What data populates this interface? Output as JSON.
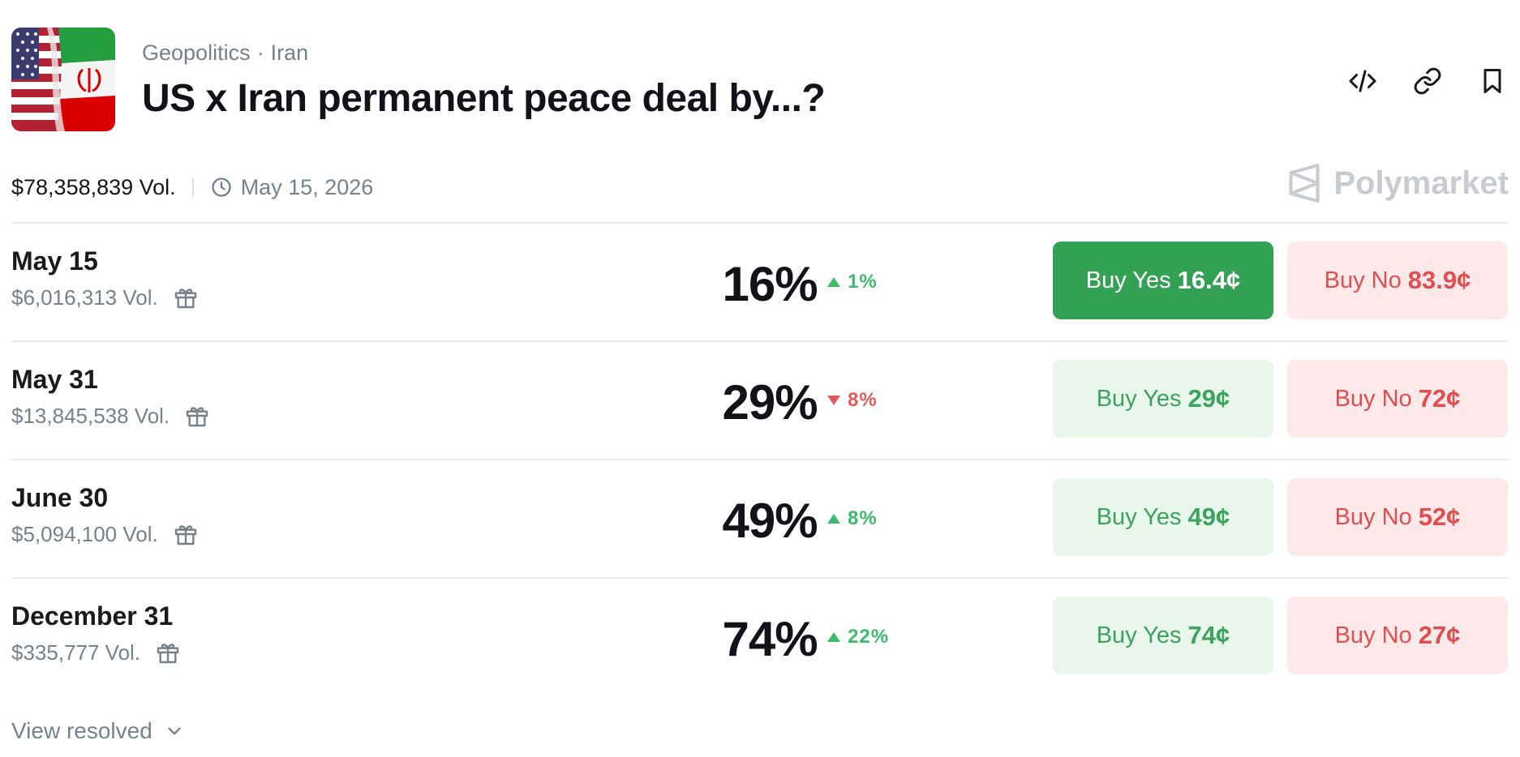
{
  "header": {
    "category": "Geopolitics",
    "subcategory": "Iran",
    "title": "US x Iran permanent peace deal by...?",
    "image_icon": "us-iran-flags-image",
    "actions": [
      {
        "name": "embed-icon"
      },
      {
        "name": "link-icon"
      },
      {
        "name": "bookmark-icon"
      }
    ]
  },
  "meta": {
    "volume": "$78,358,839 Vol.",
    "date": "May 15, 2026",
    "clock_icon": "clock-icon"
  },
  "brand": {
    "name": "Polymarket"
  },
  "markets": [
    {
      "label": "May 15",
      "volume": "$6,016,313 Vol.",
      "percent": "16%",
      "change": "1%",
      "direction": "up",
      "yes_label": "Buy Yes",
      "yes_price": "16.4¢",
      "no_label": "Buy No",
      "no_price": "83.9¢",
      "yes_active": true
    },
    {
      "label": "May 31",
      "volume": "$13,845,538 Vol.",
      "percent": "29%",
      "change": "8%",
      "direction": "down",
      "yes_label": "Buy Yes",
      "yes_price": "29¢",
      "no_label": "Buy No",
      "no_price": "72¢",
      "yes_active": false
    },
    {
      "label": "June 30",
      "volume": "$5,094,100 Vol.",
      "percent": "49%",
      "change": "8%",
      "direction": "up",
      "yes_label": "Buy Yes",
      "yes_price": "49¢",
      "no_label": "Buy No",
      "no_price": "52¢",
      "yes_active": false
    },
    {
      "label": "December 31",
      "volume": "$335,777 Vol.",
      "percent": "74%",
      "change": "22%",
      "direction": "up",
      "yes_label": "Buy Yes",
      "yes_price": "74¢",
      "no_label": "Buy No",
      "no_price": "27¢",
      "yes_active": false
    }
  ],
  "footer": {
    "view_resolved": "View resolved"
  },
  "colors": {
    "yes_active_bg": "#33a153",
    "yes_bg": "#e8f6ec",
    "yes_text": "#3ca35d",
    "no_bg": "#fde9ea",
    "no_text": "#e04e4e",
    "up": "#3dbb6a",
    "down": "#e35a5a"
  }
}
